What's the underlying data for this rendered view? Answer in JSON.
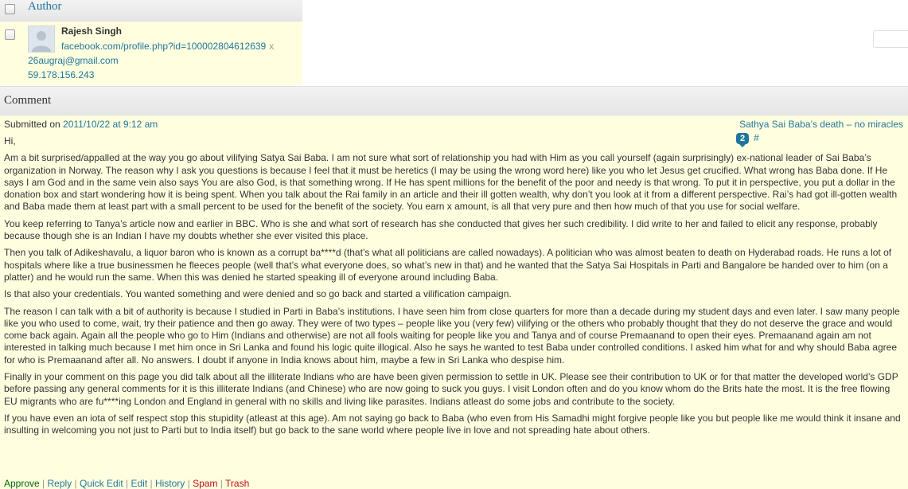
{
  "author_header": {
    "label": "Author"
  },
  "author": {
    "name": "Rajesh Singh",
    "url": "facebook.com/profile.php?id=100002804612639",
    "url_remove": "x",
    "email": "26augraj@gmail.com",
    "ip": "59.178.156.243"
  },
  "comment_header": {
    "label": "Comment"
  },
  "comment": {
    "submitted_label": "Submitted on ",
    "submitted_date": "2011/10/22 at 9:12 am",
    "post_title": "Sathya Sai Baba’s death – no miracles",
    "comment_count": "2",
    "permalink": "#",
    "paragraphs": [
      "Hi,",
      "Am a bit surprised/appalled at the way you go about vilifying Satya Sai Baba. I am not sure what sort of relationship you had with Him as you call yourself (again surprisingly) ex-national leader of Sai Baba’s organization in Norway. The reason why I ask you questions is because I feel that it must be heretics (I may be using the wrong word here) like you who let Jesus get crucified. What wrong has Baba done. If He says I am God and in the same vein also says You are also God, is that something wrong. If He has spent millions for the benefit of the poor and needy is that wrong. To put it in perspective, you put a dollar in the donation box and start wondering how it is being spent. When you talk about the Rai family in an article and their ill gotten wealth, why don’t you look at it from a different perspective. Rai’s had got ill-gotten wealth and Baba made them at least part with a small percent to be used for the benefit of the society. You earn x amount, is all that very pure and then how much of that you use for social welfare.",
      "You keep referring to Tanya’s article now and earlier in BBC. Who is she and what sort of research has she conducted that gives her such credibility. I did write to her and failed to elicit any response, probably because though she is an Indian I have my doubts whether she ever visited this place.",
      "Then you talk of Adikeshavalu, a liquor baron who is known as a corrupt ba****d (that’s what all politicians are called nowadays). A politician who was almost beaten to death on Hyderabad roads. He runs a lot of hospitals where like a true businessmen he fleeces people (well that’s what everyone does, so what’s new in that) and he wanted that the Satya Sai Hospitals in Parti and Bangalore be handed over to him (on a platter) and he would run the same. When this was denied he started speaking ill of everyone around including Baba.",
      "Is that also your credentials. You wanted something and were denied and so go back and started a vilification campaign.",
      "The reason I can talk with a bit of authority is because I studied in Parti in Baba’s institutions. I have seen him from close quarters for more than a decade during my student days and even later. I saw many people like you who used to come, wait, try their patience and then go away. They were of two types – people like you (very few) vilifying or the others who probably thought that they do not deserve the grace and would come back again. Again all the people who go to Him (Indians and otherwise) are not all fools waiting for people like you and Tanya and of course Premaanand to open their eyes. Premaanand again am not interested in talking much because I met him once in Sri Lanka and found his logic quite illogical. Also he says he wanted to test Baba under controlled conditions. I asked him what for and why should Baba agree for who is Premaanand after all. No answers. I doubt if anyone in India knows about him, maybe a few in Sri Lanka who despise him.",
      "Finally in your comment on this page you did talk about all the illiterate Indians who are have been given permission to settle in UK. Please see their contribution to UK or for that matter the developed world’s GDP before passing any general comments for it is this illiterate Indians (and Chinese) who are now going to suck you guys. I visit London often and do you know whom do the Brits hate the most. It is the free flowing EU migrants who are fu****ing London and England in general with no skills and living like parasites. Indians atleast do some jobs and contribute to the society.",
      "If you have even an iota of self respect stop this stupidity (atleast at this age). Am not saying go back to Baba (who even from His Samadhi might forgive people like you but people like me would think it insane and insulting in welcoming you not just to Parti but to India itself) but go back to the sane world where people live in love and not spreading hate about others."
    ]
  },
  "actions": {
    "approve": "Approve",
    "reply": "Reply",
    "quick_edit": "Quick Edit",
    "edit": "Edit",
    "history": "History",
    "spam": "Spam",
    "trash": "Trash",
    "separator": " | "
  },
  "colors": {
    "link": "#21759b",
    "highlight_bg": "#ffffe0",
    "approve": "#006505",
    "danger": "#bc0b0b"
  }
}
